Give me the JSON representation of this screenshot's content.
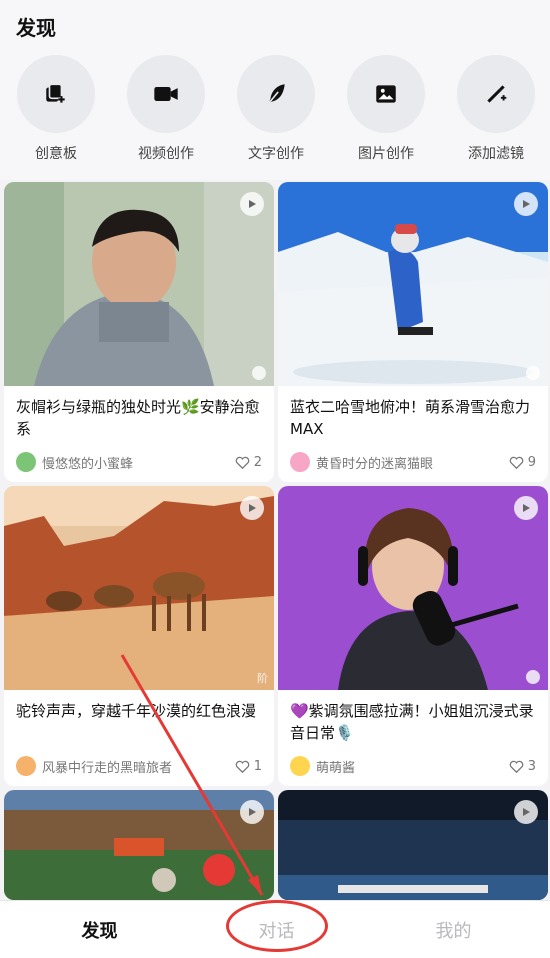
{
  "header": {
    "title": "发现"
  },
  "tools": [
    {
      "label": "创意板",
      "icon": "creative-board-icon"
    },
    {
      "label": "视频创作",
      "icon": "video-camera-icon"
    },
    {
      "label": "文字创作",
      "icon": "feather-pen-icon"
    },
    {
      "label": "图片创作",
      "icon": "image-icon"
    },
    {
      "label": "添加滤镜",
      "icon": "magic-wand-icon"
    }
  ],
  "cards": [
    {
      "title": "灰帽衫与绿瓶的独处时光🌿安静治愈系",
      "author": "慢悠悠的小蜜蜂",
      "likes": "2",
      "avatar_color": "#7cc576"
    },
    {
      "title": "蓝衣二哈雪地俯冲！萌系滑雪治愈力MAX",
      "author": "黄昏时分的迷离猫眼",
      "likes": "9",
      "avatar_color": "#f7a6c6"
    },
    {
      "title": "驼铃声声，穿越千年沙漠的红色浪漫",
      "author": "风暴中行走的黑暗旅者",
      "likes": "1",
      "avatar_color": "#f6b26b"
    },
    {
      "title": "💜紫调氛围感拉满！小姐姐沉浸式录音日常🎙️",
      "author": "萌萌酱",
      "likes": "3",
      "avatar_color": "#ffd54f"
    }
  ],
  "thumb_watermark": "阶",
  "tabs": [
    {
      "label": "发现",
      "active": true
    },
    {
      "label": "对话",
      "active": false
    },
    {
      "label": "我的",
      "active": false
    }
  ],
  "colors": {
    "annotation": "#e53935",
    "background": "#f3f3f5"
  }
}
